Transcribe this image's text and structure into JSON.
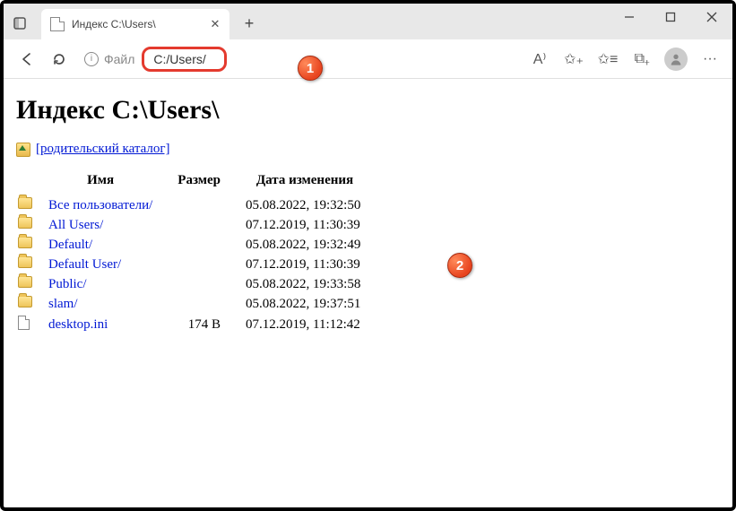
{
  "window": {
    "tab_title": "Индекс C:\\Users\\",
    "new_tab_glyph": "+",
    "close_glyph": "✕"
  },
  "toolbar": {
    "scheme_label": "Файл",
    "url": "C:/Users/",
    "info_glyph": "i",
    "read_aloud_glyph": "A⁾",
    "star_plus_glyph": "✩₊",
    "favorites_glyph": "✩≡",
    "collections_glyph": "⧉₊",
    "menu_glyph": "···"
  },
  "page": {
    "heading": "Индекс C:\\Users\\",
    "parent_link": "[родительский каталог]",
    "columns": {
      "name": "Имя",
      "size": "Размер",
      "date": "Дата изменения"
    },
    "rows": [
      {
        "icon": "folder",
        "name": "Все пользователи/",
        "size": "",
        "date": "05.08.2022, 19:32:50"
      },
      {
        "icon": "folder",
        "name": "All Users/",
        "size": "",
        "date": "07.12.2019, 11:30:39"
      },
      {
        "icon": "folder",
        "name": "Default/",
        "size": "",
        "date": "05.08.2022, 19:32:49"
      },
      {
        "icon": "folder",
        "name": "Default User/",
        "size": "",
        "date": "07.12.2019, 11:30:39"
      },
      {
        "icon": "folder",
        "name": "Public/",
        "size": "",
        "date": "05.08.2022, 19:33:58"
      },
      {
        "icon": "folder",
        "name": "slam/",
        "size": "",
        "date": "05.08.2022, 19:37:51"
      },
      {
        "icon": "file",
        "name": "desktop.ini",
        "size": "174 B",
        "date": "07.12.2019, 11:12:42"
      }
    ]
  },
  "callouts": {
    "one": "1",
    "two": "2"
  }
}
